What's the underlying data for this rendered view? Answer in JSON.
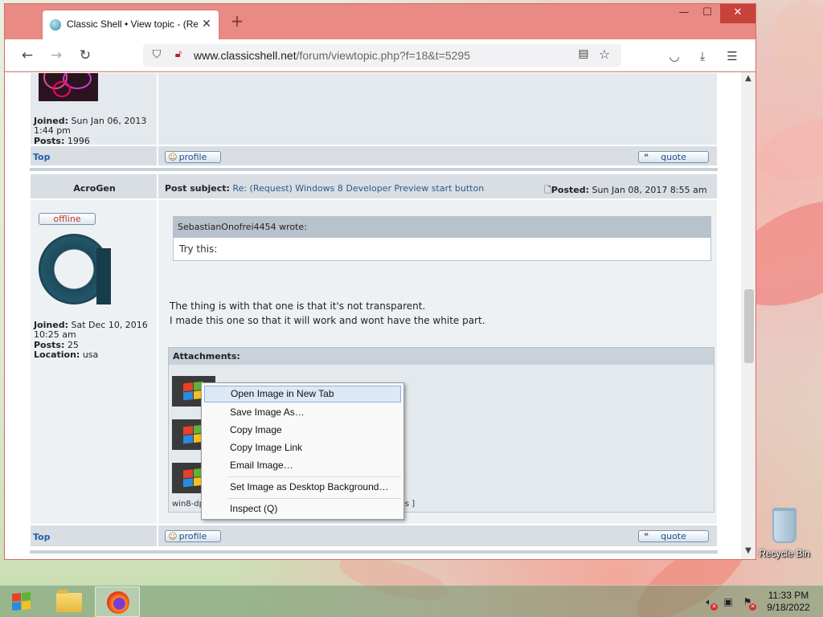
{
  "browser": {
    "tab_title": "Classic Shell • View topic - (Req",
    "tab_close": "✕",
    "new_tab": "+",
    "url_domain": "www.classicshell.net",
    "url_path": "/forum/viewtopic.php?f=18&t=5295",
    "window_controls": {
      "minimize": "—",
      "maximize": "☐",
      "close": "✕"
    }
  },
  "post_prev": {
    "joined_label": "Joined:",
    "joined_value": "Sun Jan 06, 2013 1:44 pm",
    "posts_label": "Posts:",
    "posts_value": "1996",
    "top_link": "Top",
    "profile_button": "profile",
    "quote_button": "quote"
  },
  "post": {
    "author": "AcroGen",
    "subject_label": "Post subject:",
    "subject": "Re: (Request) Windows 8 Developer Preview start button",
    "posted_label": "Posted:",
    "posted_value": "Sun Jan 08, 2017 8:55 am",
    "status": "offline",
    "joined_label": "Joined:",
    "joined_value": "Sat Dec 10, 2016 10:25 am",
    "posts_label": "Posts:",
    "posts_value": "25",
    "location_label": "Location:",
    "location_value": "usa",
    "quote_author": "SebastianOnofrei4454 wrote:",
    "quote_text": "Try this:",
    "body_line1": "The thing is with that one is that it's not transparent.",
    "body_line2": "I made this one so that it will work and wont have the white part.",
    "attachments_label": "Attachments:",
    "attachment_name": "win8-dp",
    "attachment_meta": "mes ]",
    "top_link": "Top",
    "profile_button": "profile",
    "quote_button": "quote"
  },
  "context_menu": {
    "items": [
      "Open Image in New Tab",
      "Save Image As…",
      "Copy Image",
      "Copy Image Link",
      "Email Image…",
      "Set Image as Desktop Background…",
      "Inspect (Q)"
    ]
  },
  "desktop": {
    "recycle_bin": "Recycle Bin"
  },
  "taskbar": {
    "time": "11:33 PM",
    "date": "9/18/2022"
  }
}
